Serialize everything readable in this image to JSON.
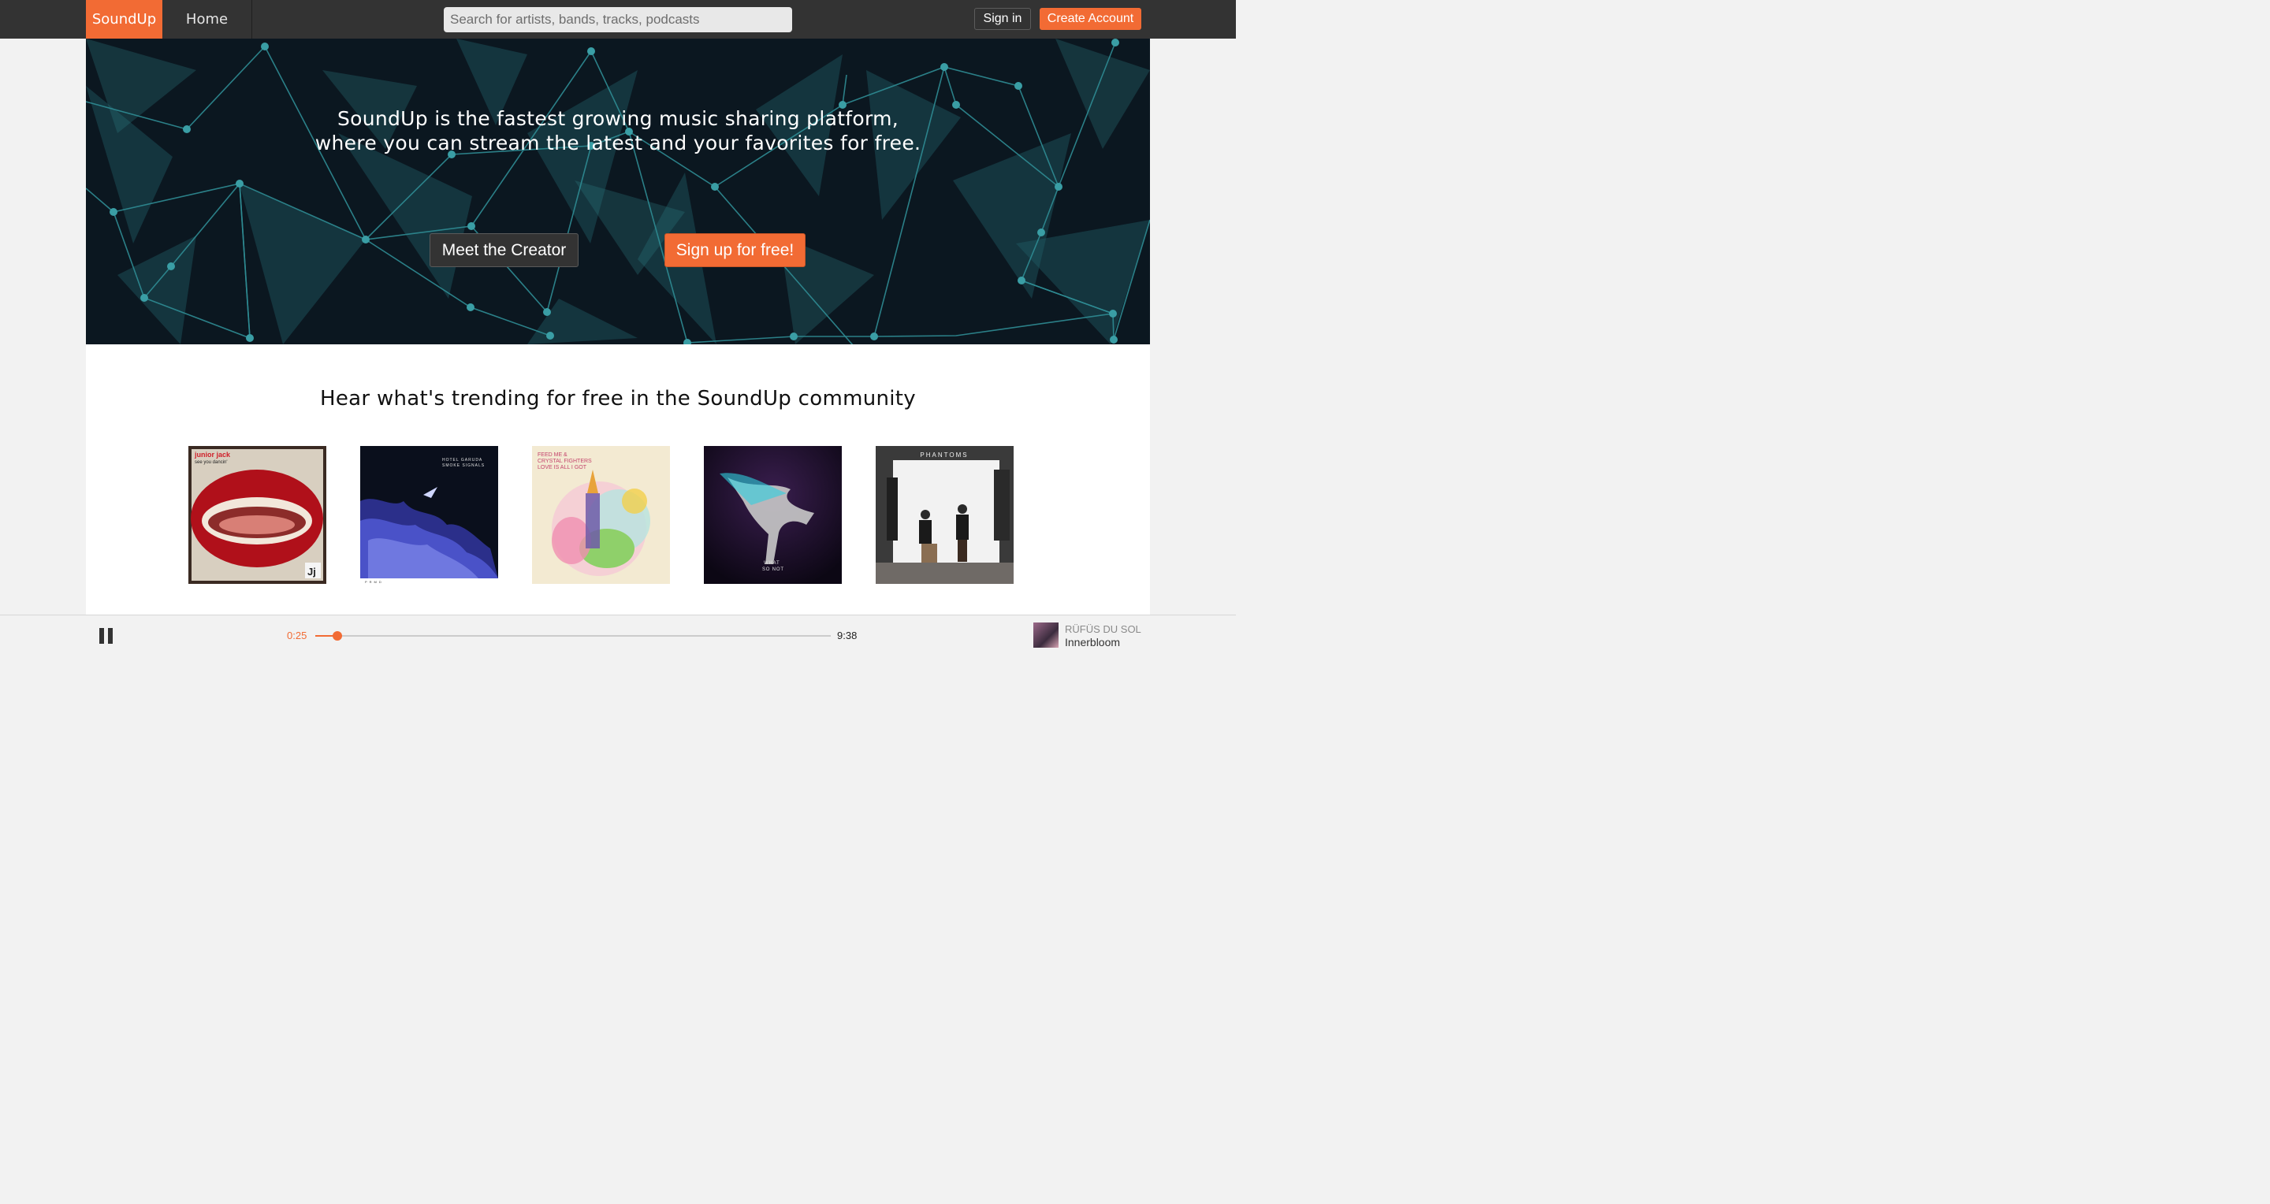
{
  "nav": {
    "logo": "SoundUp",
    "home": "Home",
    "search_placeholder": "Search for artists, bands, tracks, podcasts",
    "signin": "Sign in",
    "create_account": "Create Account"
  },
  "hero": {
    "line1": "SoundUp is the fastest growing music sharing platform,",
    "line2": "where you can stream the latest and your favorites for free.",
    "creator_button": "Meet the Creator",
    "signup_button": "Sign up for free!"
  },
  "trending": {
    "title": "Hear what's trending for free in the SoundUp community",
    "albums": [
      {
        "name": "junior-jack-album",
        "text1": "junior jack",
        "text2": "see you dancin'",
        "badge": "Jj"
      },
      {
        "name": "hotel-garuda-album",
        "text1": "HOTEL GARUDA",
        "text2": "SMOKE SIGNALS",
        "text3": "PRMD"
      },
      {
        "name": "feed-me-album",
        "text1": "FEED ME &",
        "text2": "CRYSTAL FIGHTERS",
        "text3": "LOVE IS ALL I GOT"
      },
      {
        "name": "what-so-not-album",
        "text1": "WHAT",
        "text2": "SO NOT"
      },
      {
        "name": "phantoms-album",
        "text1": "PHANTOMS"
      }
    ]
  },
  "player": {
    "current_time": "0:25",
    "total_time": "9:38",
    "progress": 0.0431,
    "artist": "RÜFÜS DU SOL",
    "title": "Innerbloom"
  },
  "colors": {
    "accent": "#f26b34",
    "nav_bg": "#333333",
    "hero_bg": "#0b1720",
    "hero_network": "#2d7a82"
  }
}
